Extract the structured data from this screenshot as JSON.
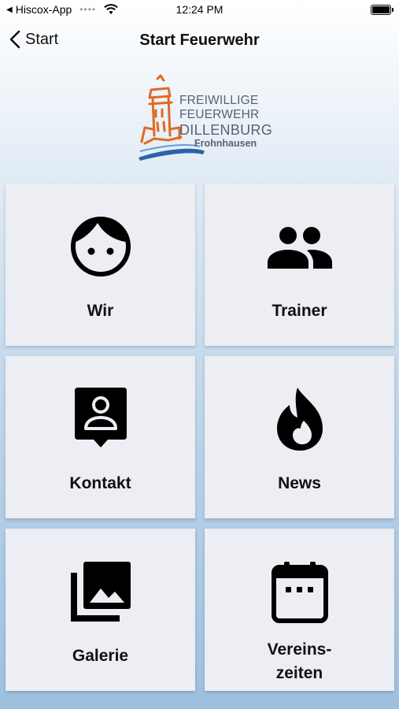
{
  "status_bar": {
    "app_name": "Hiscox-App",
    "time": "12:24 PM",
    "signal_dots": "••••",
    "back_indicator": "◀"
  },
  "nav": {
    "back_label": "Start",
    "title": "Start Feuerwehr"
  },
  "logo": {
    "line1": "FREIWILLIGE",
    "line2": "FEUERWEHR",
    "line3": "DILLENBURG",
    "line4": "Frohnhausen"
  },
  "tiles": [
    {
      "label": "Wir",
      "icon": "face-icon"
    },
    {
      "label": "Trainer",
      "icon": "people-icon"
    },
    {
      "label": "Kontakt",
      "icon": "contact-icon"
    },
    {
      "label": "News",
      "icon": "flame-icon"
    },
    {
      "label": "Galerie",
      "icon": "gallery-icon"
    },
    {
      "label_line1": "Vereins-",
      "label_line2": "zeiten",
      "icon": "calendar-icon"
    }
  ]
}
